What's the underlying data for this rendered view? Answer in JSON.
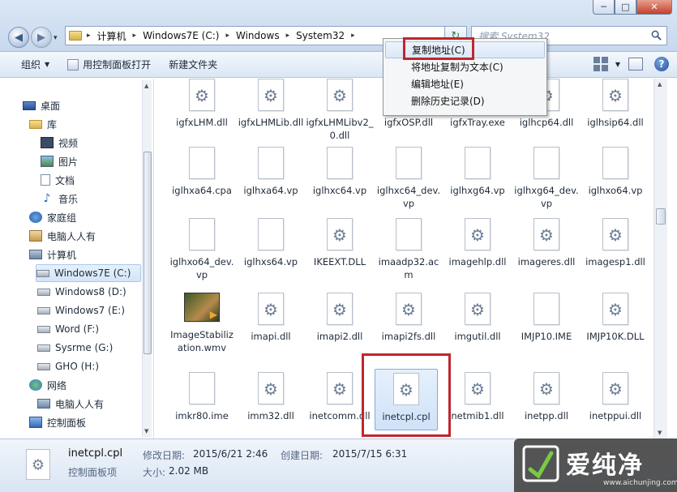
{
  "window": {
    "minimize": "─",
    "maximize": "□",
    "close": "✕"
  },
  "nav": {
    "back": "◀",
    "forward": "▶",
    "dropdown": "▾"
  },
  "address": {
    "crumbs": [
      "计算机",
      "Windows7E (C:)",
      "Windows",
      "System32"
    ],
    "sep": "▸",
    "dropdown": "▾",
    "refresh": "↻"
  },
  "search": {
    "placeholder": "搜索 System32"
  },
  "toolbar": {
    "organize": "组织",
    "open_with": "用控制面板打开",
    "new_folder": "新建文件夹",
    "caret": "▼",
    "help": "?"
  },
  "sidebar": {
    "items": [
      {
        "label": "桌面"
      },
      {
        "label": "库"
      },
      {
        "label": "视频"
      },
      {
        "label": "图片"
      },
      {
        "label": "文档"
      },
      {
        "label": "音乐"
      },
      {
        "label": "家庭组"
      },
      {
        "label": "电脑人人有"
      },
      {
        "label": "计算机"
      },
      {
        "label": "Windows7E (C:)"
      },
      {
        "label": "Windows8 (D:)"
      },
      {
        "label": "Windows7 (E:)"
      },
      {
        "label": "Word (F:)"
      },
      {
        "label": "Sysrme (G:)"
      },
      {
        "label": "GHO (H:)"
      },
      {
        "label": "网络"
      },
      {
        "label": "电脑人人有"
      },
      {
        "label": "控制面板"
      }
    ],
    "music_glyph": "♪"
  },
  "files": [
    {
      "name": "igfxLHM.dll"
    },
    {
      "name": "igfxLHMLib.dll"
    },
    {
      "name": "igfxLHMLibv2_0.dll"
    },
    {
      "name": "igfxOSP.dll"
    },
    {
      "name": "igfxTray.exe"
    },
    {
      "name": "iglhcp64.dll"
    },
    {
      "name": "iglhsip64.dll"
    },
    {
      "name": "iglhxa64.cpa"
    },
    {
      "name": "iglhxa64.vp"
    },
    {
      "name": "iglhxc64.vp"
    },
    {
      "name": "iglhxc64_dev.vp"
    },
    {
      "name": "iglhxg64.vp"
    },
    {
      "name": "iglhxg64_dev.vp"
    },
    {
      "name": "iglhxo64.vp"
    },
    {
      "name": "iglhxo64_dev.vp"
    },
    {
      "name": "iglhxs64.vp"
    },
    {
      "name": "IKEEXT.DLL"
    },
    {
      "name": "imaadp32.acm"
    },
    {
      "name": "imagehlp.dll"
    },
    {
      "name": "imageres.dll"
    },
    {
      "name": "imagesp1.dll"
    },
    {
      "name": "ImageStabilization.wmv"
    },
    {
      "name": "imapi.dll"
    },
    {
      "name": "imapi2.dll"
    },
    {
      "name": "imapi2fs.dll"
    },
    {
      "name": "imgutil.dll"
    },
    {
      "name": "IMJP10.IME"
    },
    {
      "name": "IMJP10K.DLL"
    },
    {
      "name": "imkr80.ime"
    },
    {
      "name": "imm32.dll"
    },
    {
      "name": "inetcomm.dll"
    },
    {
      "name": "inetcpl.cpl"
    },
    {
      "name": "netmib1.dll"
    },
    {
      "name": "inetpp.dll"
    },
    {
      "name": "inetppui.dll"
    }
  ],
  "context_menu": {
    "items": [
      {
        "label": "复制地址(C)"
      },
      {
        "label": "将地址复制为文本(C)"
      },
      {
        "label": "编辑地址(E)"
      },
      {
        "label": "删除历史记录(D)"
      }
    ]
  },
  "details": {
    "name": "inetcpl.cpl",
    "type": "控制面板项",
    "modified_label": "修改日期:",
    "modified_value": "2015/6/21 2:46",
    "created_label": "创建日期:",
    "created_value": "2015/7/15 6:31",
    "size_label": "大小:",
    "size_value": "2.02 MB"
  },
  "watermark": {
    "brand": "爱纯净",
    "url": "www.aichunjing.com"
  },
  "colors": {
    "highlight": "#c0262d",
    "selection": "#cfe2f8",
    "titlebar": "#c7d8ee"
  }
}
